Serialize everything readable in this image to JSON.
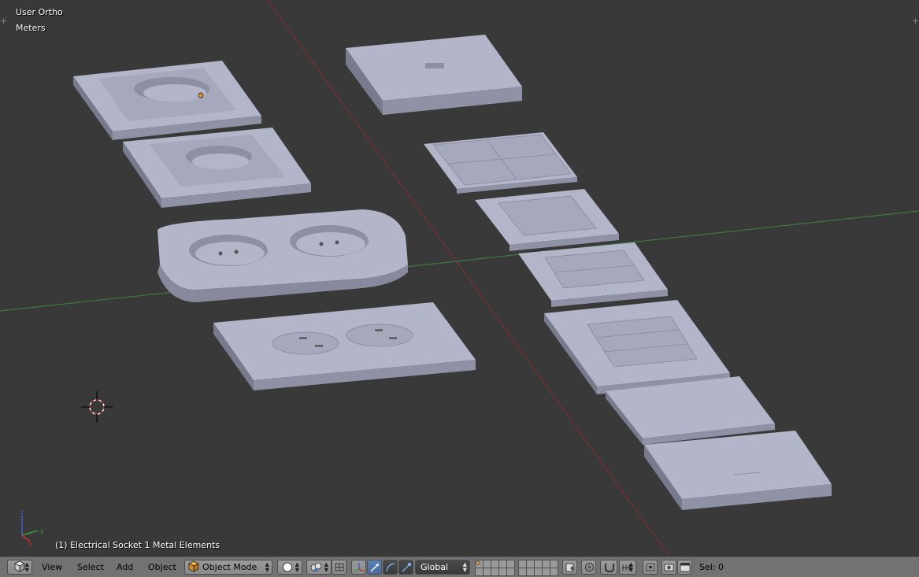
{
  "viewport": {
    "view_name": "User Ortho",
    "units": "Meters",
    "active_object_label": "(1) Electrical Socket 1 Metal Elements"
  },
  "header": {
    "editor_type_icon": "cube-icon",
    "menus": [
      "View",
      "Select",
      "Add",
      "Object"
    ],
    "mode": "Object Mode",
    "shading_icon": "sphere-solid-icon",
    "pivot_icon": "pivot-point-icon",
    "manipulator_icons": [
      "manipulator-icon",
      "translate-icon",
      "rotate-icon",
      "scale-icon"
    ],
    "orientation": "Global",
    "sel_label": "Sel: 0"
  },
  "colors": {
    "background": "#393939",
    "x_axis": "#8b2a2a",
    "y_axis": "#3e8b3e",
    "object": "#a9acbf",
    "header": "#727272"
  }
}
